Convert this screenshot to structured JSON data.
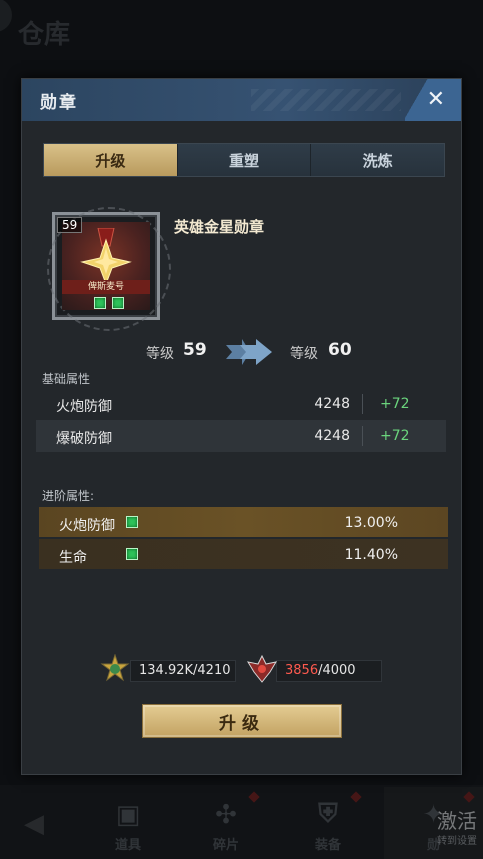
{
  "background": {
    "title": "仓库",
    "bottom_tabs": [
      {
        "label": "道具",
        "icon": "briefcase-icon",
        "dot": false
      },
      {
        "label": "碎片",
        "icon": "puzzle-icon",
        "dot": true
      },
      {
        "label": "装备",
        "icon": "armor-icon",
        "dot": true
      },
      {
        "label": "勋",
        "icon": "medal-icon",
        "dot": true
      }
    ],
    "watermark_main": "激活",
    "watermark_sub": "转到设置"
  },
  "modal": {
    "title": "勋章",
    "tabs": [
      {
        "label": "升级",
        "active": true
      },
      {
        "label": "重塑",
        "active": false
      },
      {
        "label": "洗炼",
        "active": false
      }
    ],
    "item": {
      "level": "59",
      "band_text": "俾斯麦号",
      "name": "英雄金星勋章"
    },
    "level_up": {
      "from_label": "等级",
      "from_value": "59",
      "to_label": "等级",
      "to_value": "60"
    },
    "base_attrs_label": "基础属性",
    "base_attrs": [
      {
        "name": "火炮防御",
        "value": "4248",
        "add": "+72"
      },
      {
        "name": "爆破防御",
        "value": "4248",
        "add": "+72"
      }
    ],
    "adv_attrs_label": "进阶属性:",
    "adv_attrs": [
      {
        "name": "火炮防御",
        "value": "13.00%"
      },
      {
        "name": "生命",
        "value": "11.40%"
      }
    ],
    "resources": [
      {
        "icon": "gold-star-badge-icon",
        "current": "134.92K",
        "required": "/4210"
      },
      {
        "icon": "red-emblem-icon",
        "current": "3856",
        "required": "/4000"
      }
    ],
    "upgrade_button": "升级"
  },
  "colors": {
    "accent_gold": "#d9c189",
    "header_blue": "#365272",
    "increase_green": "#6bd47d",
    "insufficient_red": "#ff5a4f"
  }
}
